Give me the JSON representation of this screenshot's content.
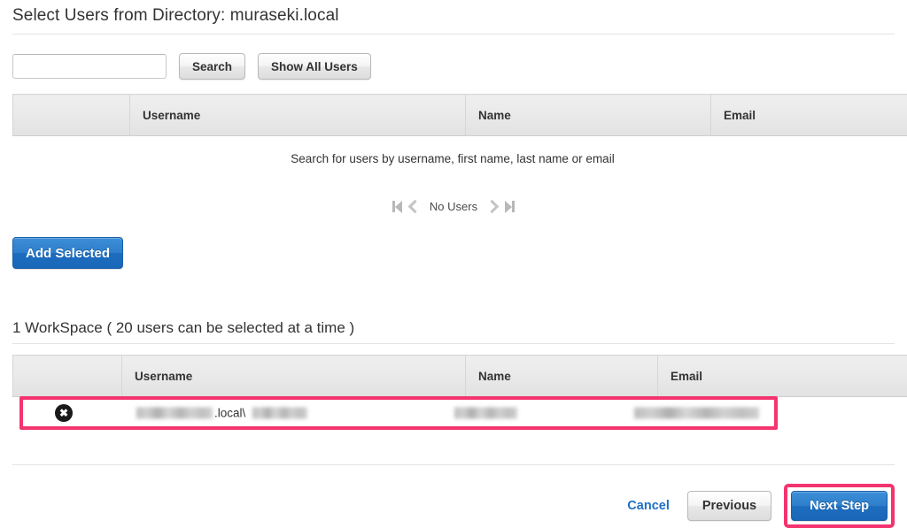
{
  "header": {
    "title": "Select Users from Directory: muraseki.local"
  },
  "search": {
    "value": "",
    "placeholder": "",
    "search_label": "Search",
    "show_all_label": "Show All Users"
  },
  "results_table": {
    "columns": [
      "",
      "Username",
      "Name",
      "Email"
    ],
    "empty_message": "Search for users by username, first name, last name or email",
    "rows": []
  },
  "pager": {
    "first_label": "first-page",
    "prev_label": "previous-page",
    "status": "No Users",
    "next_label": "next-page",
    "last_label": "last-page"
  },
  "actions": {
    "add_selected_label": "Add Selected"
  },
  "workspace": {
    "title": "1 WorkSpace ( 20 users can be selected at a time )",
    "columns": [
      "",
      "Username",
      "Name",
      "Email"
    ],
    "row": {
      "remove_label": "✖",
      "username_prefix_redacted": true,
      "username_middle": ".local\\",
      "username_suffix_redacted": true,
      "name_redacted": true,
      "email_redacted": true
    }
  },
  "footer": {
    "cancel_label": "Cancel",
    "previous_label": "Previous",
    "next_label": "Next Step"
  },
  "colors": {
    "accent_blue": "#1f6fc4",
    "highlight_pink": "#f4346f",
    "header_gray": "#e9e9e9",
    "text": "#333333"
  }
}
